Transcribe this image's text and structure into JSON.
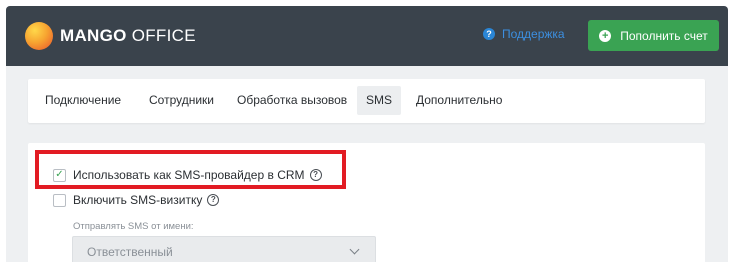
{
  "header": {
    "logo_bold": "MANGO",
    "logo_light": "OFFICE",
    "support_label": "Поддержка",
    "topup_label": "Пополнить счет"
  },
  "tabs": [
    {
      "label": "Подключение",
      "active": false
    },
    {
      "label": "Сотрудники",
      "active": false
    },
    {
      "label": "Обработка вызовов",
      "active": false
    },
    {
      "label": "SMS",
      "active": true
    },
    {
      "label": "Дополнительно",
      "active": false
    }
  ],
  "settings": {
    "use_as_sms_provider": {
      "label": "Использовать как SMS-провайдер в CRM",
      "checked": true
    },
    "enable_sms_card": {
      "label": "Включить SMS-визитку",
      "checked": false
    },
    "sender_field": {
      "label": "Отправлять SMS от имени:",
      "value": "Ответственный"
    }
  },
  "colors": {
    "topbar": "#3a434c",
    "accent_green": "#3aa353",
    "link_blue": "#3c8fe0",
    "highlight_red": "#e21b23"
  },
  "icons": {
    "support": "question-circle-icon",
    "topup": "plus-circle-icon",
    "help": "help-circle-icon",
    "select": "chevron-down-icon"
  }
}
